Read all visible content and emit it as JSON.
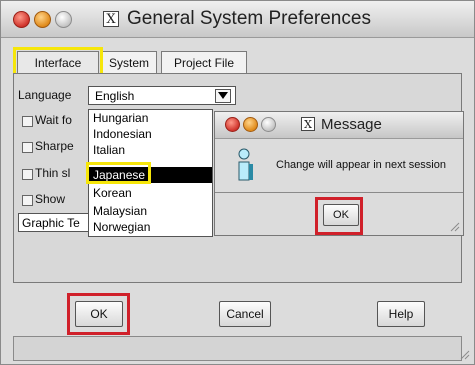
{
  "window": {
    "title": "General System Preferences",
    "tabs": [
      {
        "label": "Interface",
        "active": true
      },
      {
        "label": "System",
        "active": false
      },
      {
        "label": "Project File",
        "active": false
      }
    ]
  },
  "interface": {
    "language_label": "Language",
    "language_value": "English",
    "checkbox_labels": [
      "Wait fo",
      "Sharpe",
      "Thin sl",
      "Show"
    ],
    "graphic_label": "Graphic Te"
  },
  "language_dropdown": {
    "items": [
      "Hungarian",
      "Indonesian",
      "Italian",
      "Japanese",
      "Korean",
      "Malaysian",
      "Norwegian"
    ],
    "selected": "Japanese"
  },
  "buttons": {
    "ok": "OK",
    "cancel": "Cancel",
    "help": "Help"
  },
  "message_dialog": {
    "title": "Message",
    "text": "Change will appear in next session",
    "ok": "OK",
    "icon": "info-icon"
  },
  "highlight_colors": {
    "yellow": "#f6e60a",
    "red": "#d0202a"
  }
}
